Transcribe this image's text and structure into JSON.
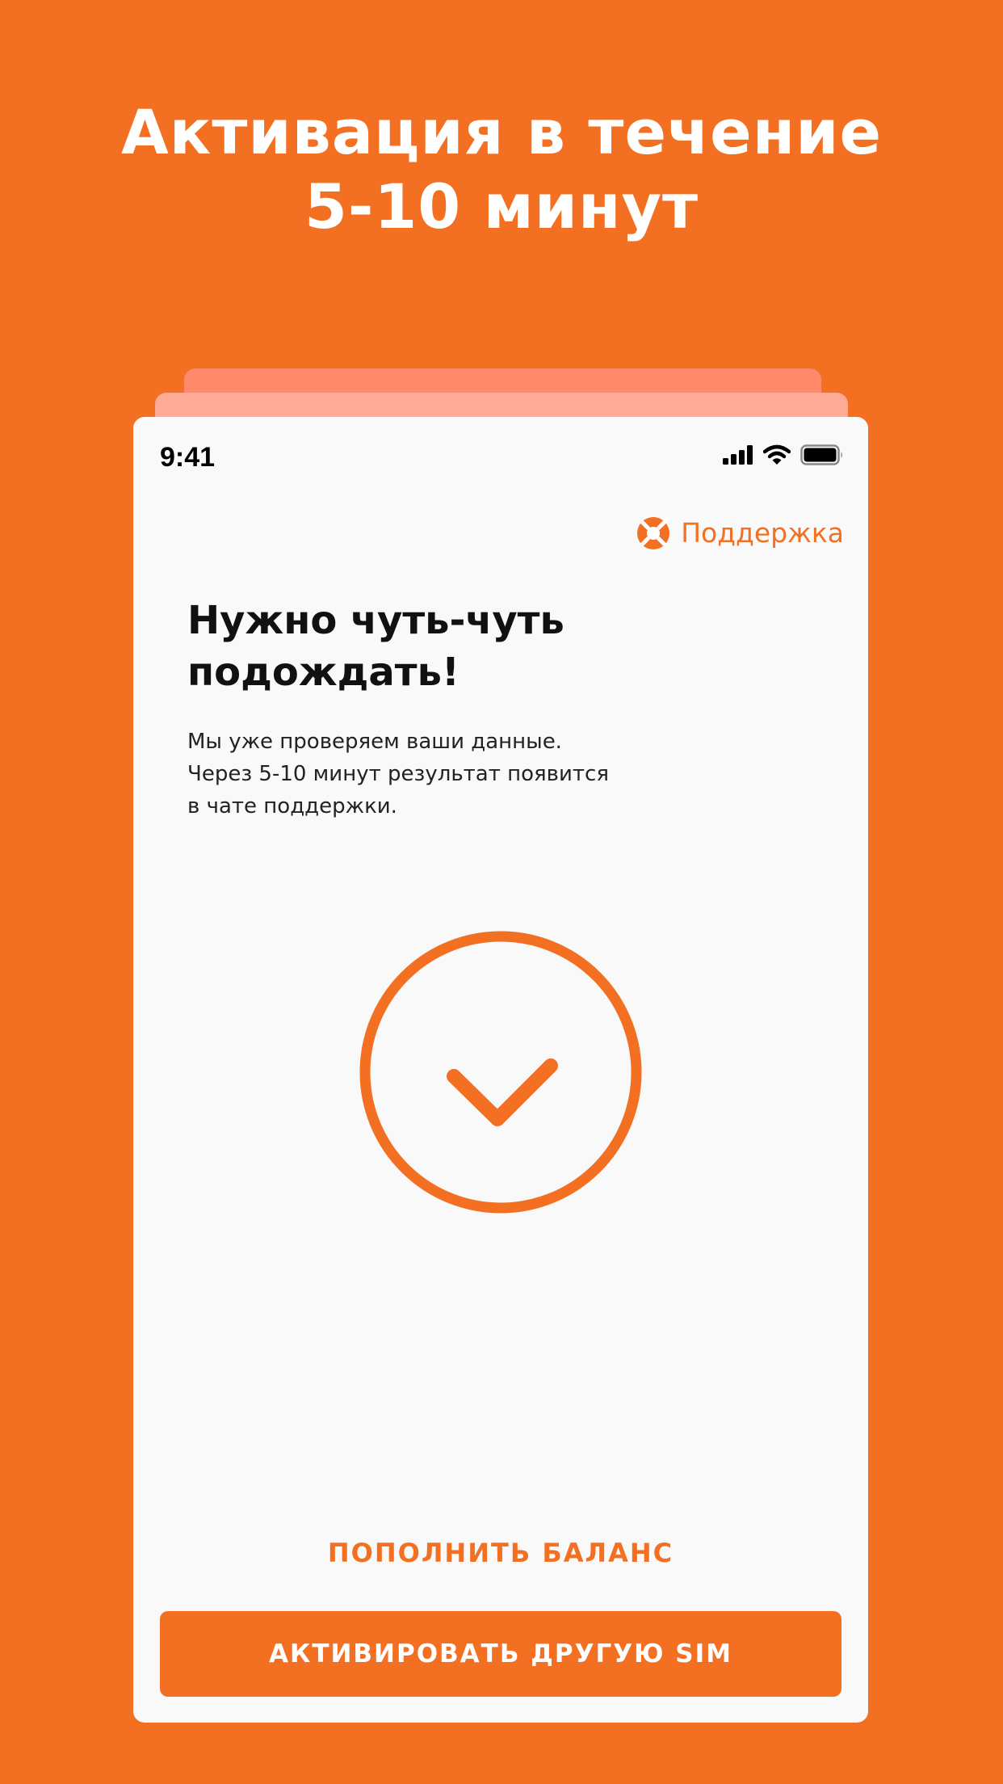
{
  "promo": {
    "headline_line1": "Активация в течение",
    "headline_line2": "5-10 минут"
  },
  "status_bar": {
    "time": "9:41",
    "icons": [
      "cellular-signal-icon",
      "wifi-icon",
      "battery-icon"
    ]
  },
  "header": {
    "support_label": "Поддержка",
    "support_icon": "lifebuoy-icon"
  },
  "content": {
    "title_line1": "Нужно чуть-чуть",
    "title_line2": "подождать!",
    "description_line1": "Мы уже проверяем ваши данные.",
    "description_line2": "Через 5-10 минут результат появится",
    "description_line3": "в чате поддержки.",
    "status_icon": "check-circle-icon"
  },
  "actions": {
    "top_up_label": "ПОПОЛНИТЬ БАЛАНС",
    "activate_other_label": "АКТИВИРОВАТЬ ДРУГУЮ SIM"
  },
  "colors": {
    "brand_orange": "#F37022",
    "stack_back": "#FF8A6B",
    "stack_mid": "#FFAA96",
    "card_background": "#F9F9F9"
  }
}
